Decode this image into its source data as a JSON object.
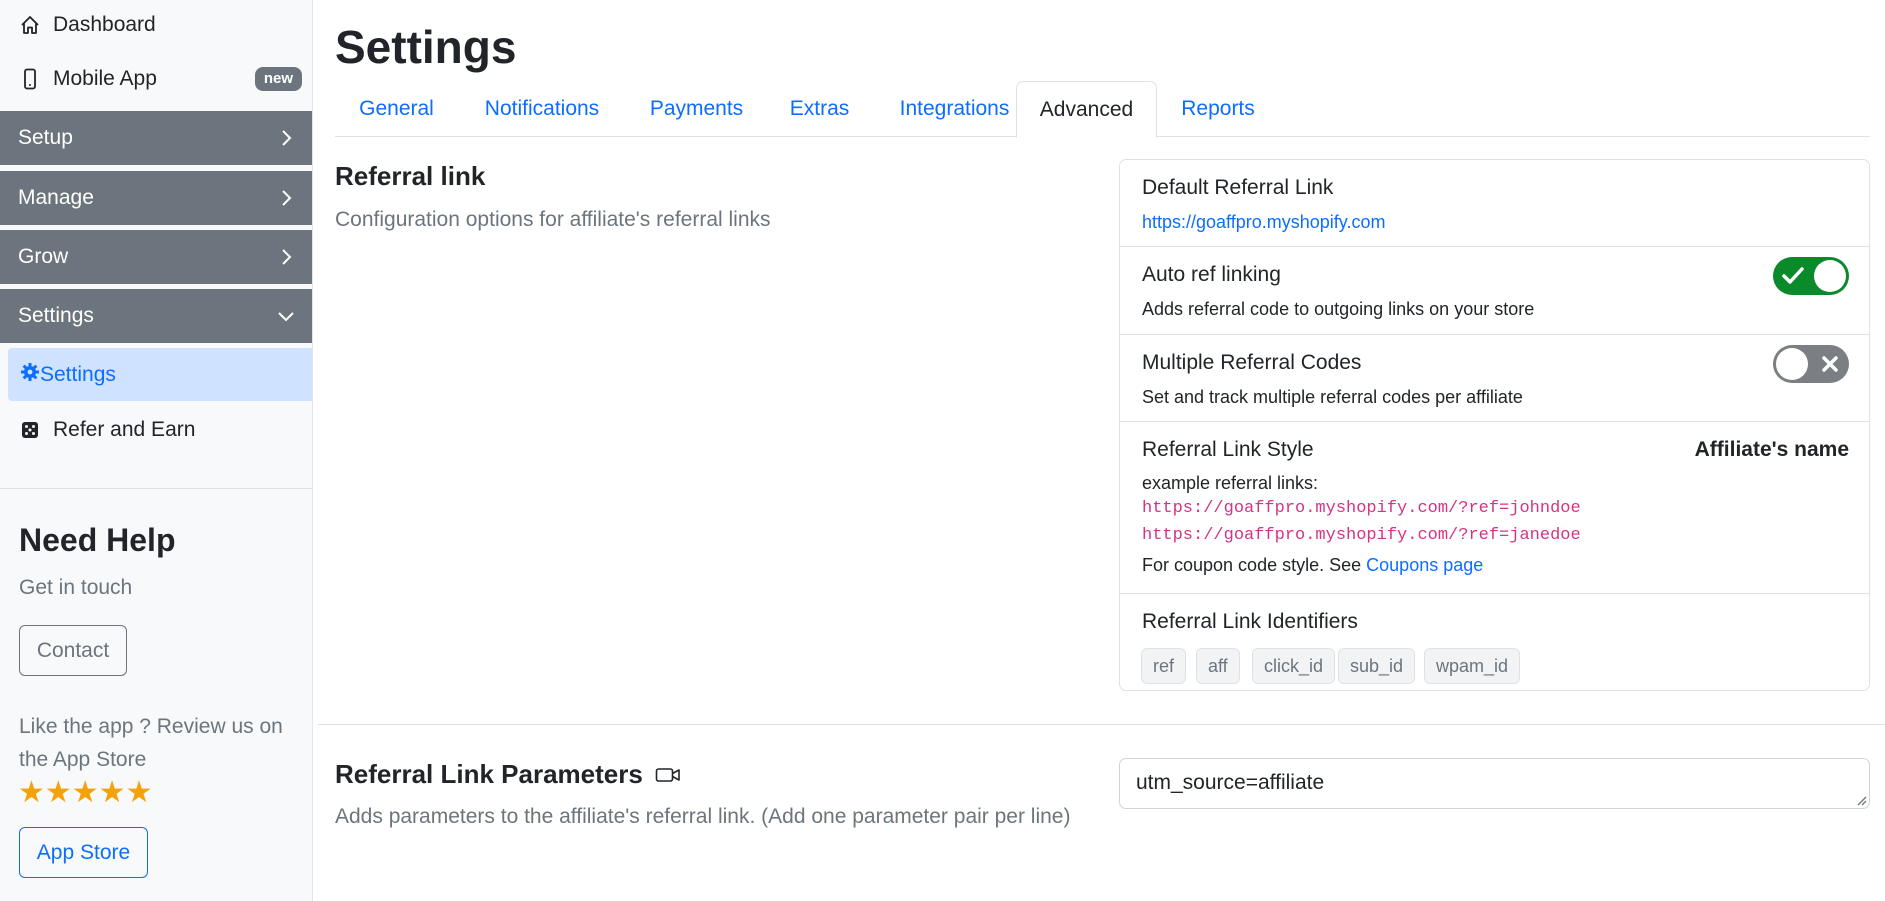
{
  "sidebar": {
    "dashboard": "Dashboard",
    "mobile_app": "Mobile App",
    "new_badge": "new",
    "groups": {
      "setup": "Setup",
      "manage": "Manage",
      "grow": "Grow",
      "settings": "Settings"
    },
    "settings_item": "Settings",
    "refer_item": "Refer and Earn",
    "help": {
      "title": "Need Help",
      "subtitle": "Get in touch",
      "contact_button": "Contact",
      "review_text": "Like the app ? Review us on the App Store",
      "stars": "★★★★★",
      "rating": 5,
      "store_button": "App Store"
    }
  },
  "page": {
    "title": "Settings"
  },
  "tabs": [
    "General",
    "Notifications",
    "Payments",
    "Extras",
    "Integrations",
    "Advanced",
    "Reports"
  ],
  "active_tab": "Advanced",
  "referral_link": {
    "title": "Referral link",
    "description": "Configuration options for affiliate's referral links",
    "default_label": "Default Referral Link",
    "default_url": "https://goaffpro.myshopify.com",
    "auto_ref": {
      "label": "Auto ref linking",
      "sub": "Adds referral code to outgoing links on your store",
      "enabled": true
    },
    "multiple_codes": {
      "label": "Multiple Referral Codes",
      "sub": "Set and track multiple referral codes per affiliate",
      "enabled": false
    },
    "style": {
      "label": "Referral Link Style",
      "value": "Affiliate's name",
      "example_label": "example referral links:",
      "examples": [
        "https://goaffpro.myshopify.com/?ref=johndoe",
        "https://goaffpro.myshopify.com/?ref=janedoe"
      ],
      "coupon_text": "For coupon code style. See",
      "coupon_link": "Coupons page"
    },
    "identifiers": {
      "label": "Referral Link Identifiers",
      "items": [
        "ref",
        "aff",
        "click_id",
        "sub_id",
        "wpam_id"
      ]
    }
  },
  "parameters": {
    "title": "Referral Link Parameters",
    "description": "Adds parameters to the affiliate's referral link. (Add one parameter pair per line)",
    "value": "utm_source=affiliate"
  },
  "colors": {
    "primary": "#0d6efd",
    "sidebar_group": "#6c757d",
    "active_bg": "#cfe2ff",
    "toggle_on": "#0a8a2b",
    "toggle_off": "#7b7f84",
    "code": "#d63384",
    "star": "#f4a20c"
  }
}
